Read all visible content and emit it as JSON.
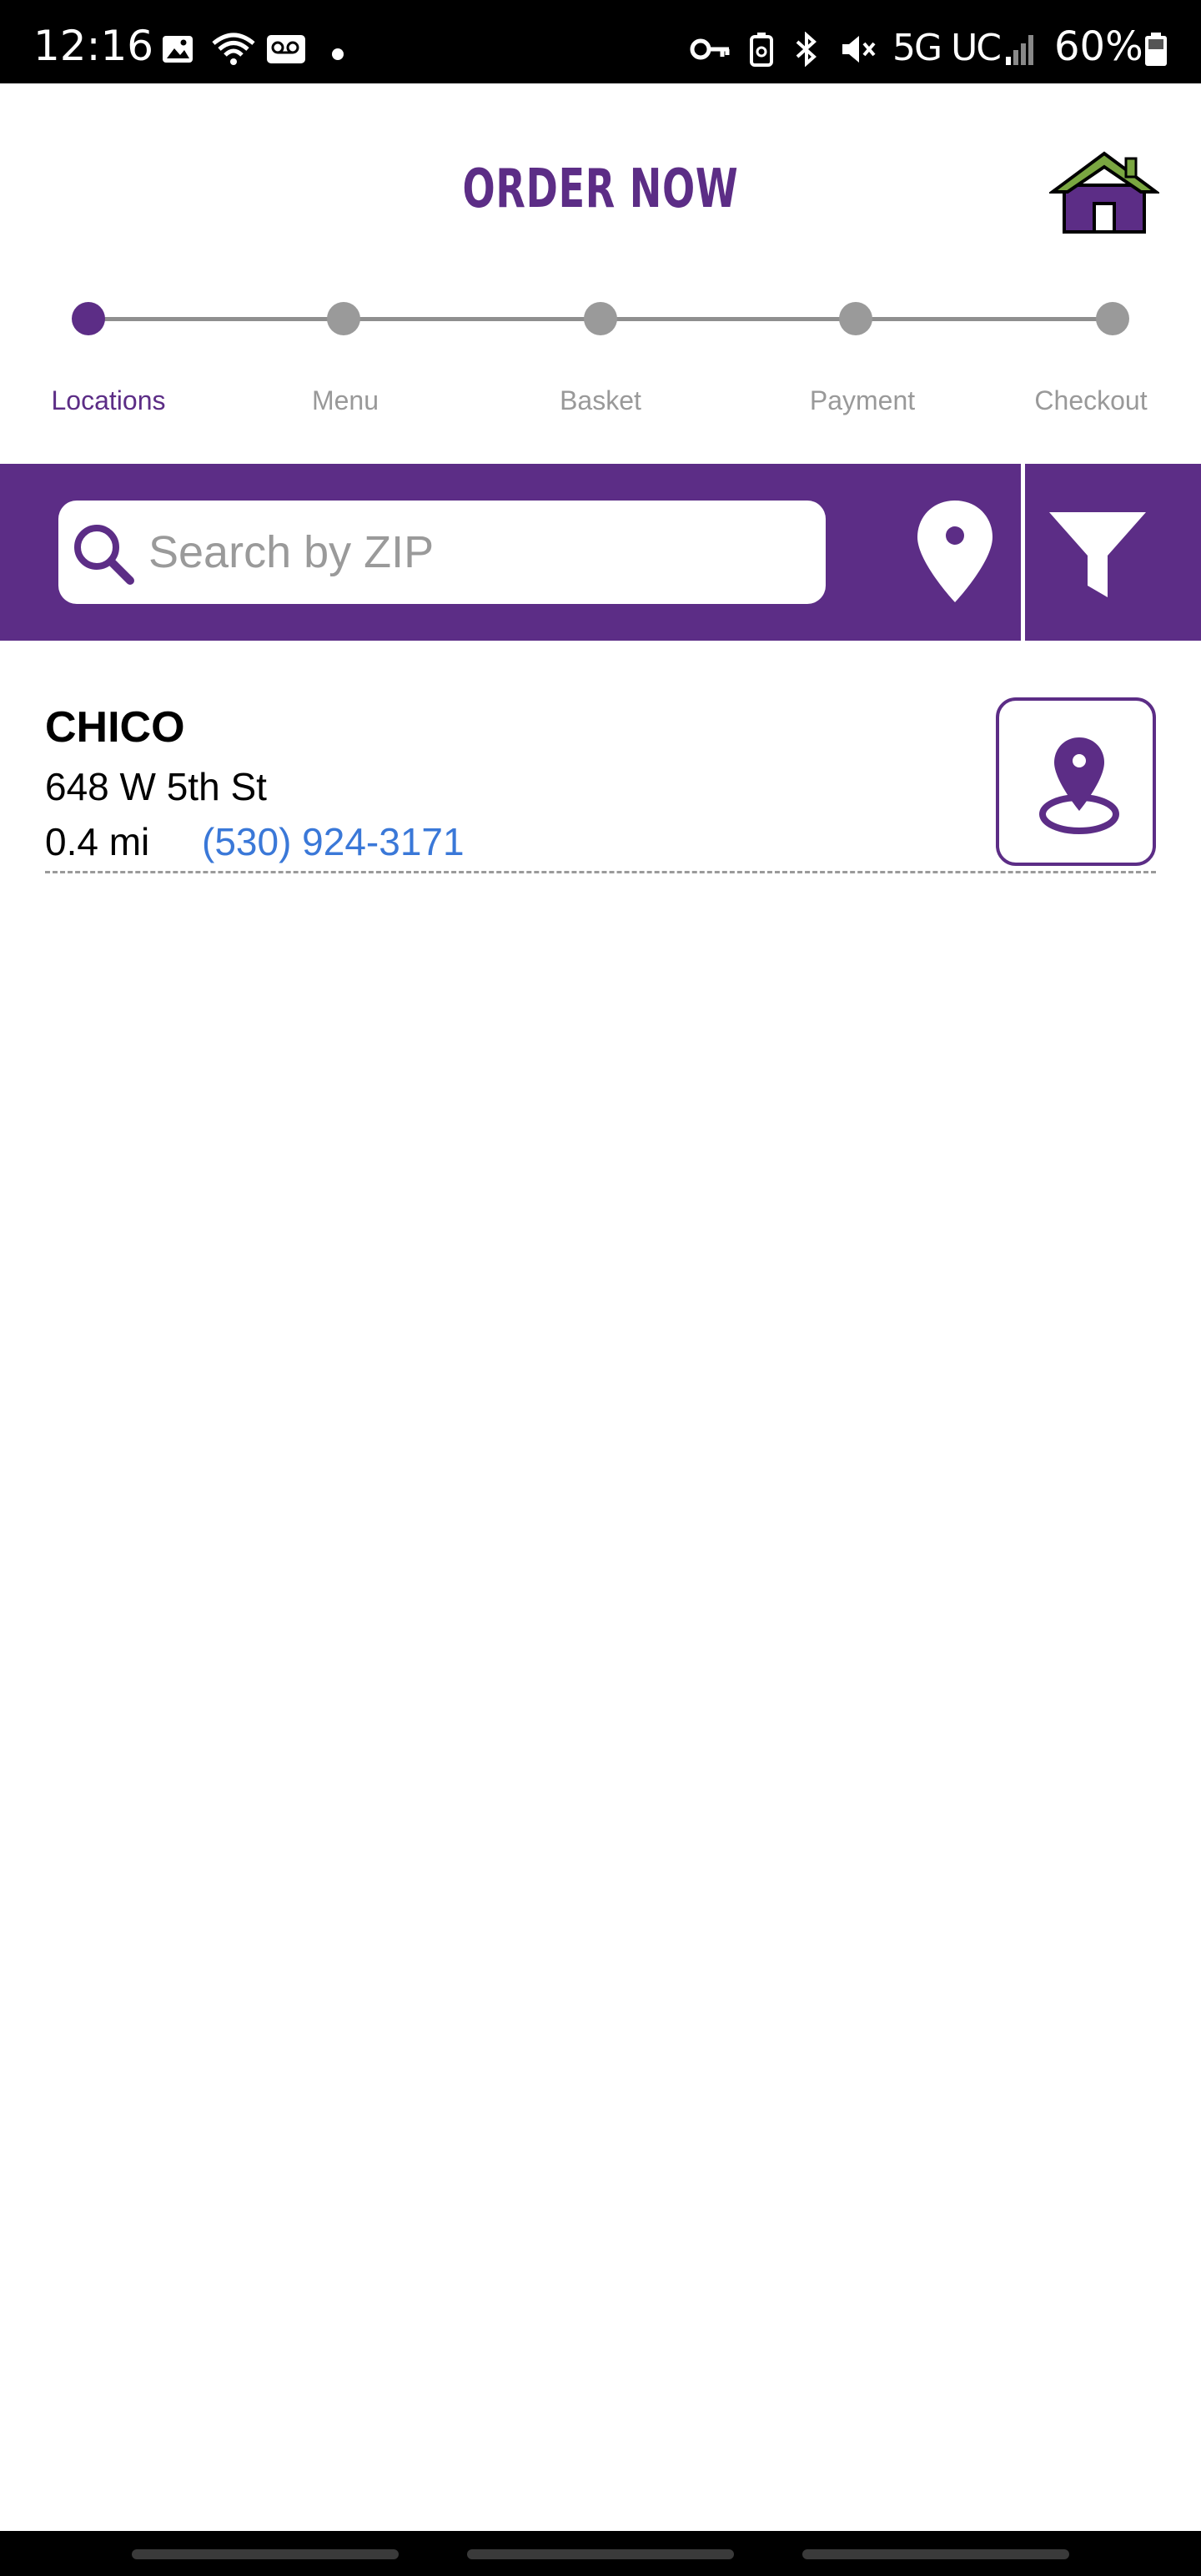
{
  "status_bar": {
    "time": "12:16",
    "network": "5G UC",
    "battery": "60%",
    "icons": [
      "image-icon",
      "wifi-icon",
      "voicemail-icon",
      "key-icon",
      "battery-saver-icon",
      "bluetooth-icon",
      "mute-icon",
      "signal-icon",
      "battery-icon"
    ]
  },
  "header": {
    "title": "ORDER NOW",
    "home_icon": "home-icon"
  },
  "steps": [
    {
      "label": "Locations",
      "active": true
    },
    {
      "label": "Menu",
      "active": false
    },
    {
      "label": "Basket",
      "active": false
    },
    {
      "label": "Payment",
      "active": false
    },
    {
      "label": "Checkout",
      "active": false
    }
  ],
  "search": {
    "placeholder": "Search by ZIP",
    "value": ""
  },
  "locations": [
    {
      "name": "CHICO",
      "address": "648 W 5th St",
      "distance": "0.4 mi",
      "phone": "(530) 924-3171"
    }
  ],
  "colors": {
    "brand_purple": "#5c2d86",
    "link_blue": "#3a78d8",
    "inactive_gray": "#9a9a9a",
    "roof_green": "#7aa641"
  }
}
